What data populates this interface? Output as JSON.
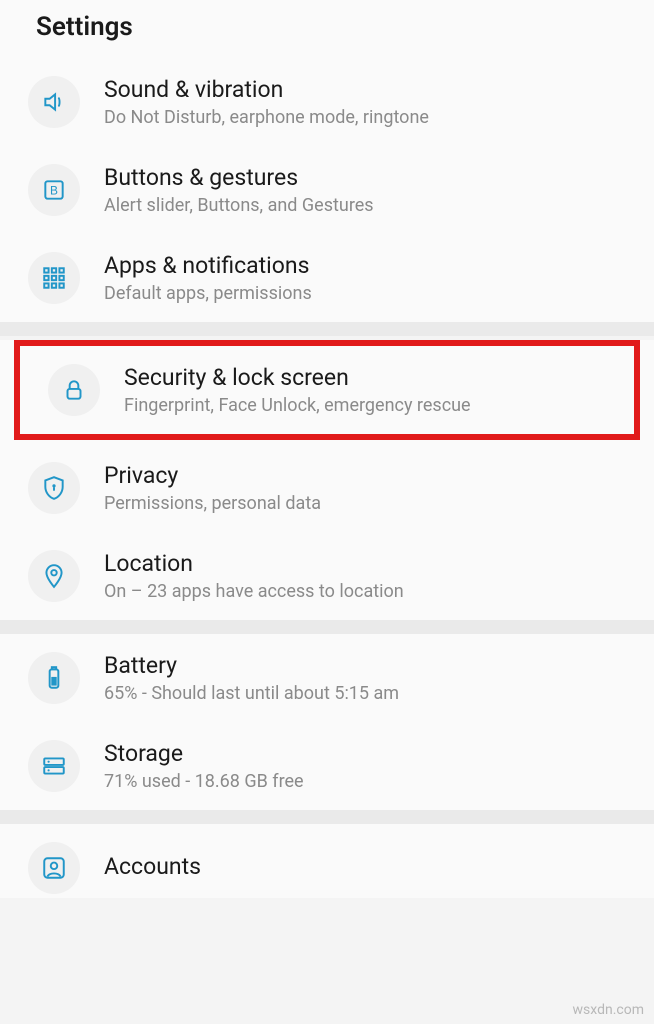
{
  "page": {
    "title": "Settings"
  },
  "groups": [
    {
      "items": [
        {
          "icon": "speaker-icon",
          "title": "Sound & vibration",
          "subtitle": "Do Not Disturb, earphone mode, ringtone"
        },
        {
          "icon": "button-box-icon",
          "title": "Buttons & gestures",
          "subtitle": "Alert slider, Buttons, and Gestures"
        },
        {
          "icon": "grid-icon",
          "title": "Apps & notifications",
          "subtitle": "Default apps, permissions"
        }
      ]
    },
    {
      "items": [
        {
          "icon": "lock-icon",
          "title": "Security & lock screen",
          "subtitle": "Fingerprint, Face Unlock, emergency rescue",
          "highlighted": true
        },
        {
          "icon": "shield-icon",
          "title": "Privacy",
          "subtitle": "Permissions, personal data"
        },
        {
          "icon": "pin-icon",
          "title": "Location",
          "subtitle": "On – 23 apps have access to location"
        }
      ]
    },
    {
      "items": [
        {
          "icon": "battery-icon",
          "title": "Battery",
          "subtitle": "65% - Should last until about 5:15 am"
        },
        {
          "icon": "storage-icon",
          "title": "Storage",
          "subtitle": "71% used - 18.68 GB free"
        }
      ]
    },
    {
      "items": [
        {
          "icon": "account-icon",
          "title": "Accounts",
          "subtitle": ""
        }
      ]
    }
  ],
  "watermark": "wsxdn.com"
}
